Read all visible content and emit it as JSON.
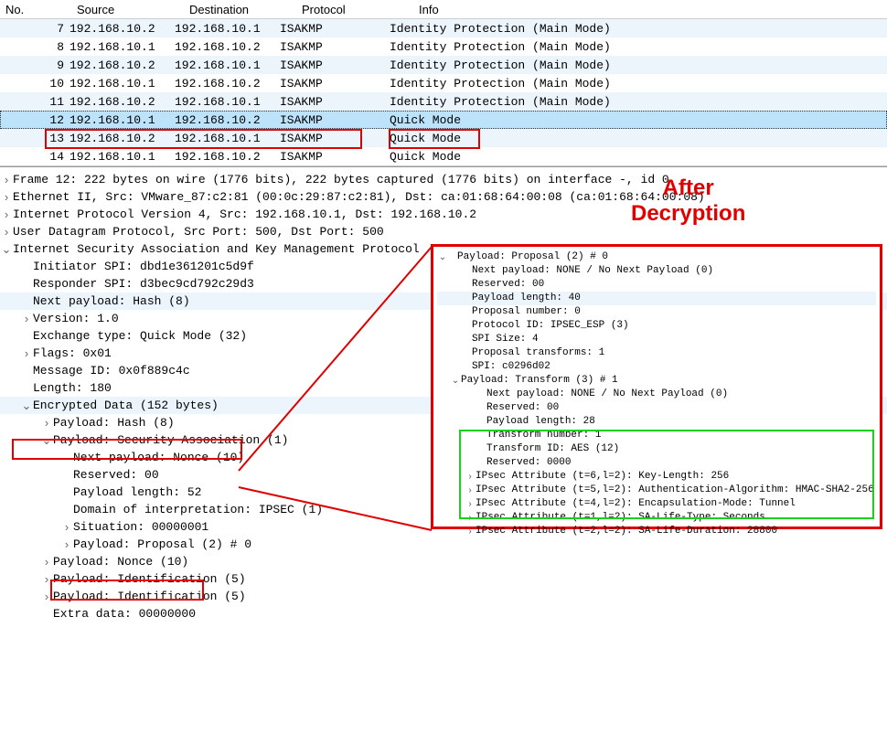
{
  "columns": {
    "no": "No.",
    "src": "Source",
    "dst": "Destination",
    "proto": "Protocol",
    "info": "Info"
  },
  "rows": [
    {
      "no": "7",
      "src": "192.168.10.2",
      "dst": "192.168.10.1",
      "proto": "ISAKMP",
      "info": "Identity Protection (Main Mode)"
    },
    {
      "no": "8",
      "src": "192.168.10.1",
      "dst": "192.168.10.2",
      "proto": "ISAKMP",
      "info": "Identity Protection (Main Mode)"
    },
    {
      "no": "9",
      "src": "192.168.10.2",
      "dst": "192.168.10.1",
      "proto": "ISAKMP",
      "info": "Identity Protection (Main Mode)"
    },
    {
      "no": "10",
      "src": "192.168.10.1",
      "dst": "192.168.10.2",
      "proto": "ISAKMP",
      "info": "Identity Protection (Main Mode)"
    },
    {
      "no": "11",
      "src": "192.168.10.2",
      "dst": "192.168.10.1",
      "proto": "ISAKMP",
      "info": "Identity Protection (Main Mode)"
    },
    {
      "no": "12",
      "src": "192.168.10.1",
      "dst": "192.168.10.2",
      "proto": "ISAKMP",
      "info": "Quick Mode"
    },
    {
      "no": "13",
      "src": "192.168.10.2",
      "dst": "192.168.10.1",
      "proto": "ISAKMP",
      "info": "Quick Mode"
    },
    {
      "no": "14",
      "src": "192.168.10.1",
      "dst": "192.168.10.2",
      "proto": "ISAKMP",
      "info": "Quick Mode"
    }
  ],
  "selected_row": 5,
  "details": {
    "frame": "Frame 12: 222 bytes on wire (1776 bits), 222 bytes captured (1776 bits) on interface -, id 0",
    "eth": "Ethernet II, Src: VMware_87:c2:81 (00:0c:29:87:c2:81), Dst: ca:01:68:64:00:08 (ca:01:68:64:00:08)",
    "ip": "Internet Protocol Version 4, Src: 192.168.10.1, Dst: 192.168.10.2",
    "udp": "User Datagram Protocol, Src Port: 500, Dst Port: 500",
    "isakmp": "Internet Security Association and Key Management Protocol",
    "ispi": "Initiator SPI: dbd1e361201c5d9f",
    "rspi": "Responder SPI: d3bec9cd792c29d3",
    "nextp": "Next payload: Hash (8)",
    "ver": "Version: 1.0",
    "exch": "Exchange type: Quick Mode (32)",
    "flags": "Flags: 0x01",
    "mid": "Message ID: 0x0f889c4c",
    "len": "Length: 180",
    "encd": "Encrypted Data (152 bytes)",
    "phash": "Payload: Hash (8)",
    "psa": "Payload: Security Association (1)",
    "nextp2": "Next payload: Nonce (10)",
    "res": "Reserved: 00",
    "plen": "Payload length: 52",
    "doi": "Domain of interpretation: IPSEC (1)",
    "sit": "Situation: 00000001",
    "pprop": "Payload: Proposal (2) # 0",
    "pnonce": "Payload: Nonce (10)",
    "pid1": "Payload: Identification (5)",
    "pid2": "Payload: Identification (5)",
    "extra": "Extra data: 00000000"
  },
  "callout": {
    "title1": "After",
    "title2": "Decryption",
    "lines": {
      "l0": "Payload: Proposal (2) # 0",
      "l1": "Next payload: NONE / No Next Payload  (0)",
      "l2": "Reserved: 00",
      "l3": "Payload length: 40",
      "l4": "Proposal number: 0",
      "l5": "Protocol ID: IPSEC_ESP (3)",
      "l6": "SPI Size: 4",
      "l7": "Proposal transforms: 1",
      "l8": "SPI: c0296d02",
      "l9": "Payload: Transform (3) # 1",
      "l10": "Next payload: NONE / No Next Payload  (0)",
      "l11": "Reserved: 00",
      "l12": "Payload length: 28",
      "l13": "Transform number: 1",
      "l14": "Transform ID: AES (12)",
      "l15": "Reserved: 0000",
      "l16": "IPsec Attribute (t=6,l=2): Key-Length: 256",
      "l17": "IPsec Attribute (t=5,l=2): Authentication-Algorithm: HMAC-SHA2-256",
      "l18": "IPsec Attribute (t=4,l=2): Encapsulation-Mode: Tunnel",
      "l19": "IPsec Attribute (t=1,l=2): SA-Life-Type: Seconds",
      "l20": "IPsec Attribute (t=2,l=2): SA-Life-Duration: 28800"
    }
  }
}
